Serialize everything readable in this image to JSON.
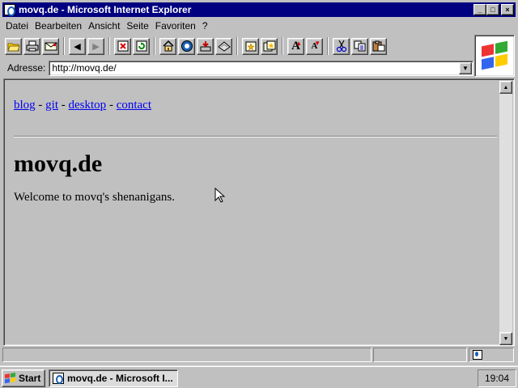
{
  "window": {
    "title": "movq.de - Microsoft Internet Explorer",
    "buttons": {
      "minimize": "_",
      "maximize": "□",
      "close": "×"
    }
  },
  "menu": [
    {
      "label": "Datei"
    },
    {
      "label": "Bearbeiten"
    },
    {
      "label": "Ansicht"
    },
    {
      "label": "Seite"
    },
    {
      "label": "Favoriten"
    },
    {
      "label": "?"
    }
  ],
  "toolbar": {
    "icons": [
      "open-icon",
      "print-icon",
      "mail-icon",
      "back-icon",
      "forward-icon",
      "stop-icon",
      "refresh-icon",
      "home-icon",
      "search-icon",
      "download-icon",
      "channels-icon",
      "favorites-add-icon",
      "favorites-open-icon",
      "font-larger-icon",
      "font-smaller-icon",
      "cut-icon",
      "copy-icon",
      "paste-icon"
    ],
    "glyphs": {
      "back": "◀",
      "forward": "▶",
      "font_larger": "A",
      "font_smaller": "A"
    }
  },
  "address": {
    "label": "Adresse:",
    "value": "http://movq.de/",
    "dropdown": "▼"
  },
  "page": {
    "links": [
      {
        "label": "blog"
      },
      {
        "label": "git"
      },
      {
        "label": "desktop"
      },
      {
        "label": "contact"
      }
    ],
    "separator": "-",
    "heading": "movq.de",
    "welcome": "Welcome to movq's shenanigans."
  },
  "scrollbar": {
    "up": "▲",
    "down": "▼"
  },
  "statusbar": {
    "text": ""
  },
  "taskbar": {
    "start_label": "Start",
    "task_label": "movq.de - Microsoft I...",
    "clock": "19:04"
  },
  "colors": {
    "titlebar": "#000080",
    "face": "#c0c0c0",
    "link": "#0000ee"
  }
}
